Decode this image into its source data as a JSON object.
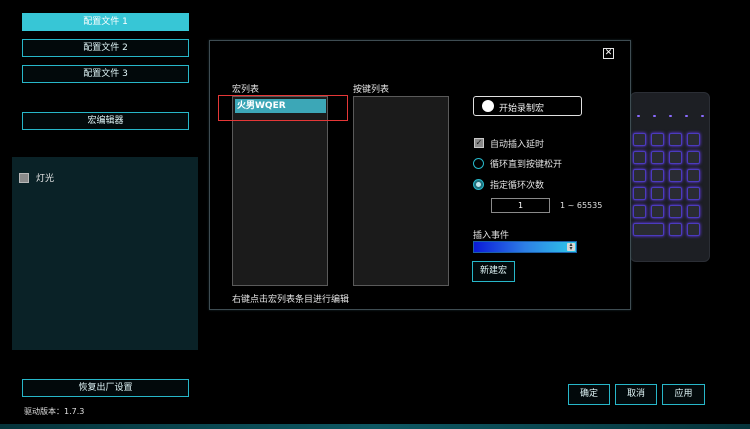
{
  "profiles": {
    "items": [
      {
        "label": "配置文件 1",
        "active": true
      },
      {
        "label": "配置文件 2",
        "active": false
      },
      {
        "label": "配置文件 3",
        "active": false
      }
    ]
  },
  "sidebar": {
    "macro_editor_label": "宏编辑器",
    "light_label": "灯光",
    "factory_reset_label": "恢复出厂设置",
    "version_text": "驱动版本：1.7.3"
  },
  "footer": {
    "confirm_label": "确定",
    "cancel_label": "取消",
    "apply_label": "应用"
  },
  "dialog": {
    "close_glyph": "✕",
    "macro_list_title": "宏列表",
    "key_list_title": "按键列表",
    "macro_items": [
      "火男WQER"
    ],
    "hint_text": "右键点击宏列表条目进行编辑",
    "record_label": "开始录制宏",
    "auto_delay_label": "自动插入延时",
    "loop_until_release_label": "循环直到按键松开",
    "loop_count_label": "指定循环次数",
    "loop_count_value": "1",
    "loop_range_text": "1 ~ 65535",
    "insert_event_label": "插入事件",
    "new_macro_label": "新建宏"
  },
  "colors": {
    "accent": "#27b7c9",
    "active_button": "#37c6d6",
    "selection_highlight": "#e53737"
  }
}
